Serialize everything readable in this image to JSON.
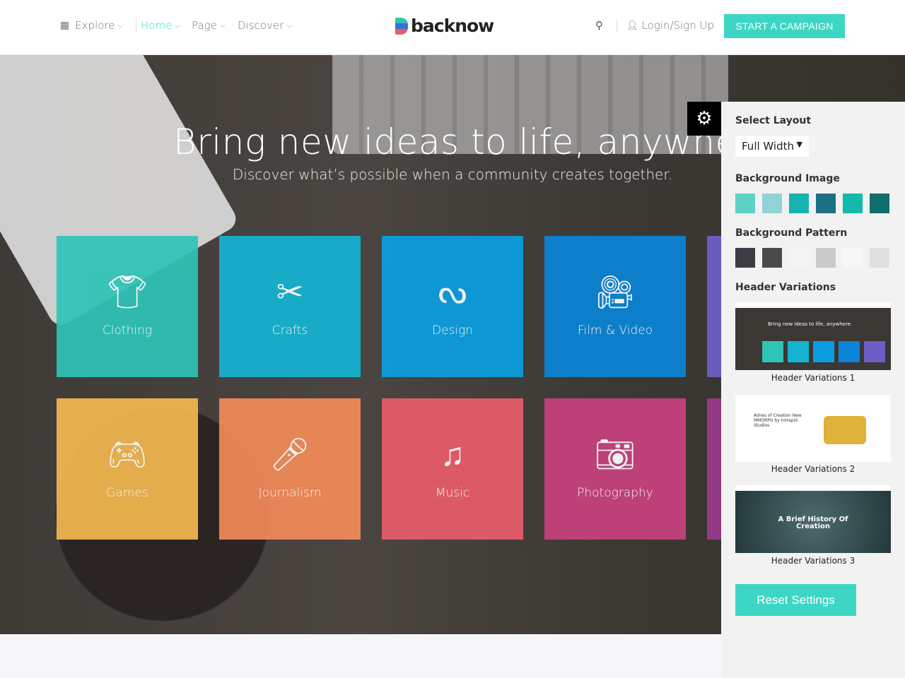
{
  "header": {
    "nav": [
      {
        "label": "Explore",
        "icon": "grid-icon"
      },
      {
        "label": "Home",
        "active": true
      },
      {
        "label": "Page"
      },
      {
        "label": "Discover"
      }
    ],
    "logo": "backnow",
    "login": "Login/Sign Up",
    "cta": "START A CAMPAIGN"
  },
  "hero": {
    "title": "Bring new ideas to life, anywhere.",
    "subtitle": "Discover what’s possible when a community creates together."
  },
  "categories": [
    {
      "label": "Clothing",
      "icon": "shirt-icon",
      "color": "#2ec4b6"
    },
    {
      "label": "Crafts",
      "icon": "scissors-icon",
      "color": "#14b3d2"
    },
    {
      "label": "Design",
      "icon": "design-icon",
      "color": "#0a9ee0"
    },
    {
      "label": "Film & Video",
      "icon": "video-camera-icon",
      "color": "#0a84d6"
    },
    {
      "label": "",
      "icon": "",
      "color": "#6b5fc7"
    },
    {
      "label": "Games",
      "icon": "gamepad-icon",
      "color": "#f2b84f"
    },
    {
      "label": "Journalism",
      "icon": "microphone-icon",
      "color": "#f28a58"
    },
    {
      "label": "Music",
      "icon": "music-note-icon",
      "color": "#e85c6a"
    },
    {
      "label": "Photography",
      "icon": "camera-icon",
      "color": "#c8417e"
    },
    {
      "label": "",
      "icon": "",
      "color": "#9b3a8a"
    }
  ],
  "panel": {
    "select_layout": "Select Layout",
    "layout_value": "Full Width",
    "background_image": "Background Image",
    "bg_images": [
      "#5fd0c4",
      "#8fd3d8",
      "#16b3b0",
      "#1d6f86",
      "#14b9ae",
      "#0f6f6c"
    ],
    "background_pattern": "Background Pattern",
    "patterns": [
      "#3d3d44",
      "#4a4a4a",
      "#f4f4f4",
      "#c9c9c9",
      "#f7f7f7",
      "#e0e0e0"
    ],
    "header_variations": "Header Variations",
    "variations": [
      {
        "label": "Header Variations 1",
        "text": "Bring new ideas to life, anywhere."
      },
      {
        "label": "Header Variations 2",
        "text": "Ashes of Creation New MMORPG by Intrepid Studios"
      },
      {
        "label": "Header Variations 3",
        "text": "A Brief History Of Creation"
      }
    ],
    "reset": "Reset Settings"
  }
}
